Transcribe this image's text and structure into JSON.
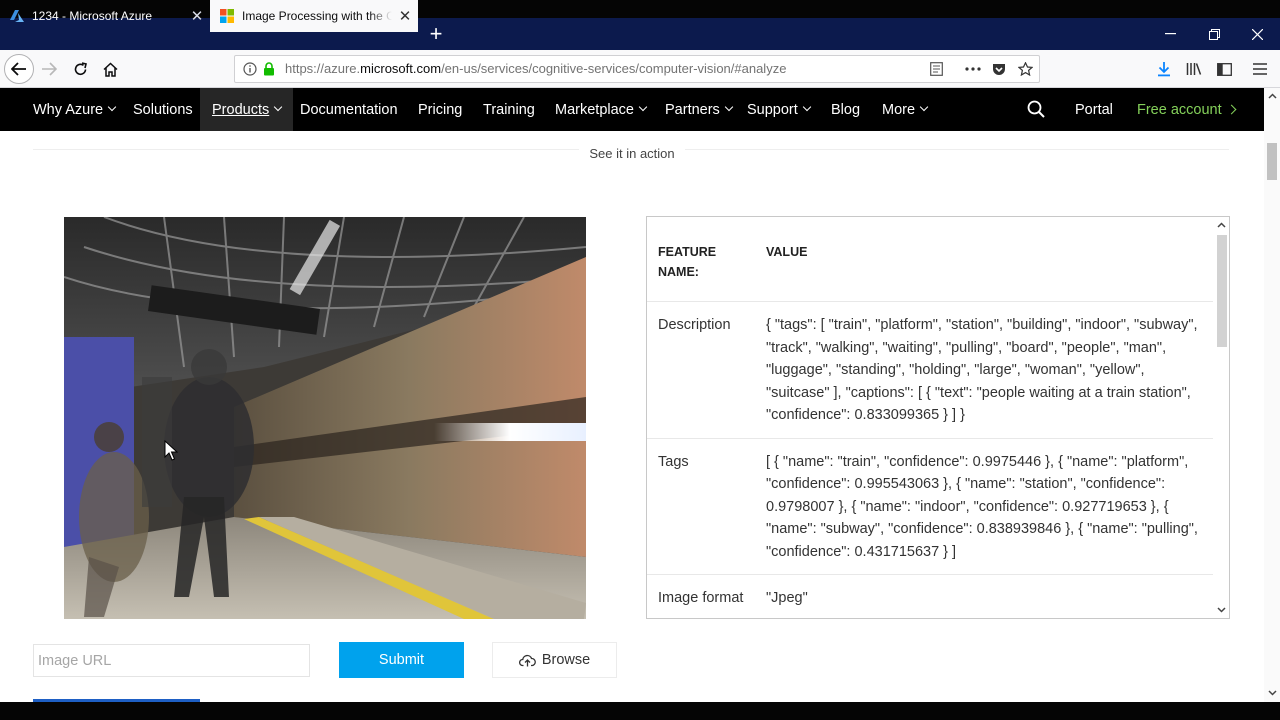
{
  "browser": {
    "tabs": [
      {
        "title": "1234 - Microsoft Azure",
        "active": false
      },
      {
        "title": "Image Processing with the Computer Vision API",
        "active": true
      }
    ],
    "url": {
      "prefix": "https://azure.",
      "domain": "microsoft.com",
      "path": "/en-us/services/cognitive-services/computer-vision/#analyze"
    }
  },
  "azure_nav": {
    "items": [
      "Why Azure",
      "Solutions",
      "Products",
      "Documentation",
      "Pricing",
      "Training",
      "Marketplace",
      "Partners",
      "Support",
      "Blog",
      "More"
    ],
    "portal": "Portal",
    "free_account": "Free account",
    "accent_green": "#84d05a"
  },
  "page": {
    "section_label": "See it in action",
    "results": {
      "header_key": "FEATURE NAME:",
      "header_value": "VALUE",
      "rows": [
        {
          "key": "Description",
          "value": "{ \"tags\": [ \"train\", \"platform\", \"station\", \"building\", \"indoor\", \"subway\", \"track\", \"walking\", \"waiting\", \"pulling\", \"board\", \"people\", \"man\", \"luggage\", \"standing\", \"holding\", \"large\", \"woman\", \"yellow\", \"suitcase\" ], \"captions\": [ { \"text\": \"people waiting at a train station\", \"confidence\": 0.833099365 } ] }"
        },
        {
          "key": "Tags",
          "value": "[ { \"name\": \"train\", \"confidence\": 0.9975446 }, { \"name\": \"platform\", \"confidence\": 0.995543063 }, { \"name\": \"station\", \"confidence\": 0.9798007 }, { \"name\": \"indoor\", \"confidence\": 0.927719653 }, { \"name\": \"subway\", \"confidence\": 0.838939846 }, { \"name\": \"pulling\", \"confidence\": 0.431715637 } ]"
        },
        {
          "key": "Image format",
          "value": "\"Jpeg\""
        }
      ]
    },
    "image_url_placeholder": "Image URL",
    "submit_label": "Submit",
    "browse_label": "Browse",
    "accent_blue": "#00a2ed"
  }
}
